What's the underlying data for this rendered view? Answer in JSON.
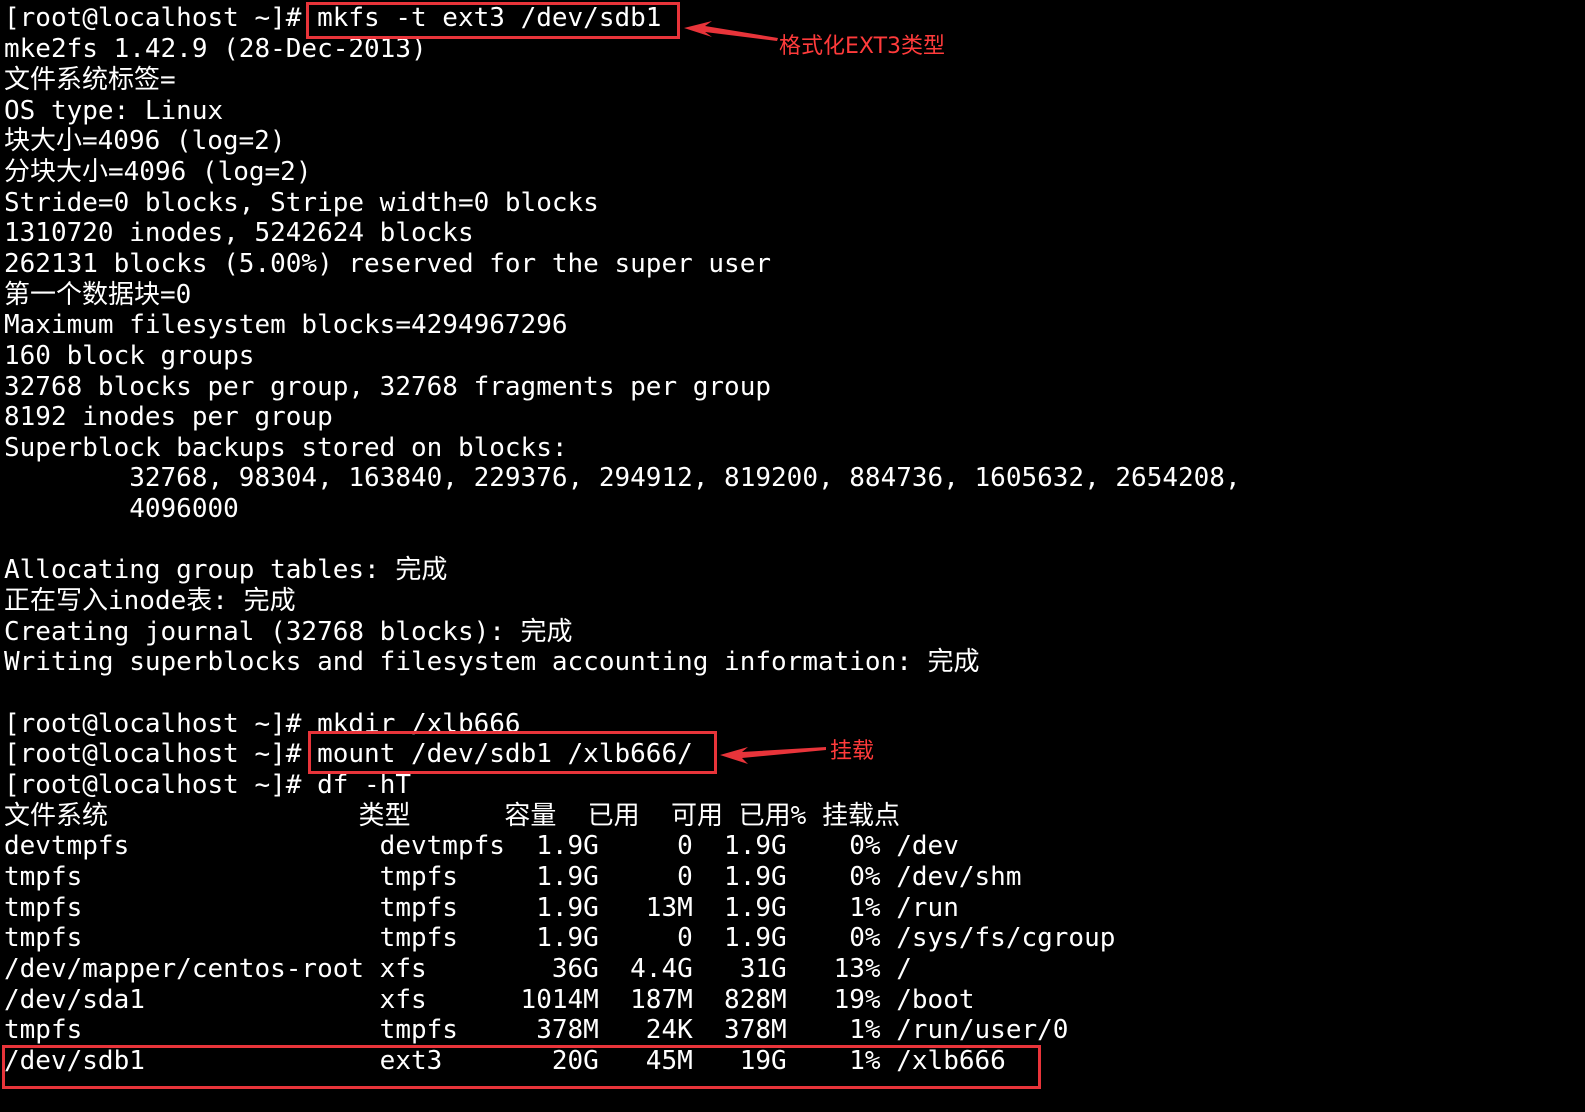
{
  "terminal": {
    "prompt": "[root@localhost ~]# ",
    "commands": {
      "mkfs": "mkfs -t ext3 /dev/sdb1",
      "mkdir": "mkdir /xlb666",
      "mount": "mount /dev/sdb1 /xlb666/",
      "df": "df -hT"
    },
    "mkfs_output": [
      "mke2fs 1.42.9 (28-Dec-2013)",
      "文件系统标签=",
      "OS type: Linux",
      "块大小=4096 (log=2)",
      "分块大小=4096 (log=2)",
      "Stride=0 blocks, Stripe width=0 blocks",
      "1310720 inodes, 5242624 blocks",
      "262131 blocks (5.00%) reserved for the super user",
      "第一个数据块=0",
      "Maximum filesystem blocks=4294967296",
      "160 block groups",
      "32768 blocks per group, 32768 fragments per group",
      "8192 inodes per group",
      "Superblock backups stored on blocks:",
      "        32768, 98304, 163840, 229376, 294912, 819200, 884736, 1605632, 2654208,",
      "        4096000",
      "",
      "Allocating group tables: 完成",
      "正在写入inode表: 完成",
      "Creating journal (32768 blocks): 完成",
      "Writing superblocks and filesystem accounting information: 完成"
    ],
    "df_header": "文件系统                类型      容量  已用  可用 已用% 挂载点",
    "df_rows": [
      "devtmpfs                devtmpfs  1.9G     0  1.9G    0% /dev",
      "tmpfs                   tmpfs     1.9G     0  1.9G    0% /dev/shm",
      "tmpfs                   tmpfs     1.9G   13M  1.9G    1% /run",
      "tmpfs                   tmpfs     1.9G     0  1.9G    0% /sys/fs/cgroup",
      "/dev/mapper/centos-root xfs        36G  4.4G   31G   13% /",
      "/dev/sda1               xfs      1014M  187M  828M   19% /boot",
      "tmpfs                   tmpfs     378M   24K  378M    1% /run/user/0",
      "/dev/sdb1               ext3       20G   45M   19G    1% /xlb666"
    ]
  },
  "annotations": {
    "format_note": "格式化EXT3类型",
    "mount_note": "挂载"
  },
  "colors": {
    "background": "#000000",
    "text": "#ffffff",
    "annotation": "#e8343a"
  }
}
